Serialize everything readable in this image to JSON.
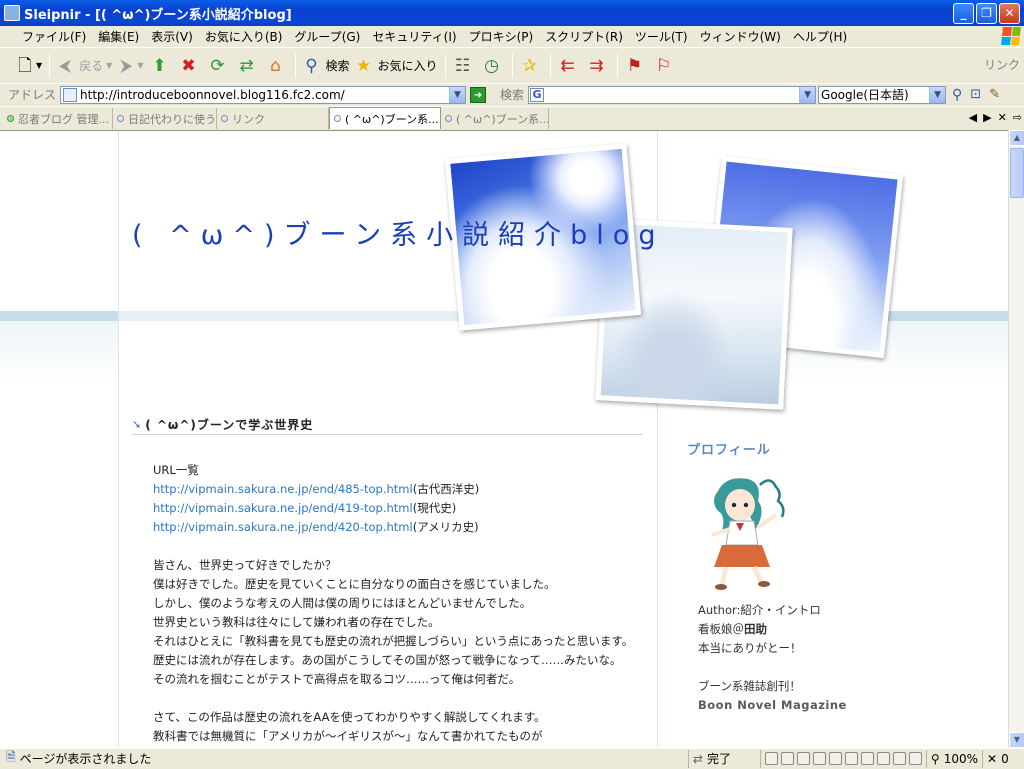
{
  "window": {
    "title": "Sleipnir - [( ^ω^)ブーン系小説紹介blog]"
  },
  "menu": [
    "ファイル(F)",
    "編集(E)",
    "表示(V)",
    "お気に入り(B)",
    "グループ(G)",
    "セキュリティ(I)",
    "プロキシ(P)",
    "スクリプト(R)",
    "ツール(T)",
    "ウィンドウ(W)",
    "ヘルプ(H)"
  ],
  "toolbar": {
    "back_label": "戻る",
    "search_label": "検索",
    "favorites_label": "お気に入り",
    "links_label": "リンク"
  },
  "address": {
    "label": "アドレス",
    "url": "http://introduceboonnovel.blog116.fc2.com/",
    "search_label": "検索",
    "search_value": "",
    "engine": "Google(日本語)"
  },
  "tabs": [
    {
      "label": "忍者ブログ 管理...",
      "icon": "green-dot"
    },
    {
      "label": "日記代わりに使う...",
      "icon": "blue-dot"
    },
    {
      "label": "リンク",
      "icon": "blue-dot"
    },
    {
      "label": "( ^ω^)ブーン系...",
      "icon": "blue-dot",
      "active": true
    },
    {
      "label": "( ^ω^)ブーン系...",
      "icon": "blue-dot"
    }
  ],
  "blog": {
    "title": "( ^ω^)ブーン系小説紹介blog",
    "entry_title": "( ^ω^)ブーンで学ぶ世界史",
    "body": [
      {
        "text": "URL一覧"
      },
      {
        "url": "http://vipmain.sakura.ne.jp/end/485-top.html",
        "note": "(古代西洋史)"
      },
      {
        "url": "http://vipmain.sakura.ne.jp/end/419-top.html",
        "note": "(現代史)"
      },
      {
        "url": "http://vipmain.sakura.ne.jp/end/420-top.html",
        "note": "(アメリカ史)"
      },
      {
        "blank": true
      },
      {
        "text": "皆さん、世界史って好きでしたか？"
      },
      {
        "text": "僕は好きでした。歴史を見ていくことに自分なりの面白さを感じていました。"
      },
      {
        "text": "しかし、僕のような考えの人間は僕の周りにはほとんどいませんでした。"
      },
      {
        "text": "世界史という教科は往々にして嫌われ者の存在でした。"
      },
      {
        "text": "それはひとえに「教科書を見ても歴史の流れが把握しづらい」という点にあったと思います。"
      },
      {
        "text": "歴史には流れが存在します。あの国がこうしてその国が怒って戦争になって……みたいな。"
      },
      {
        "text": "その流れを掴むことがテストで高得点を取るコツ……って俺は何者だ。"
      },
      {
        "blank": true
      },
      {
        "text": "さて、この作品は歴史の流れをAAを使ってわかりやすく解説してくれます。"
      },
      {
        "text": "教科書では無機質に「アメリカが～イギリスが～」なんて書かれてたものが"
      }
    ],
    "profile": {
      "heading": "プロフィール",
      "author": "Author:紹介・イントロ",
      "mascot_prefix": "看板娘＠",
      "mascot_name": "田助",
      "thanks": "本当にありがとー！",
      "announce": "ブーン系雑誌創刊！",
      "magazine": "Boon Novel Magazine"
    }
  },
  "status": {
    "message": "ページが表示されました",
    "state": "完了",
    "zoom": "100%",
    "count": "0"
  },
  "colors": {
    "title_blue": "#1a3fb8",
    "link": "#2a78c8",
    "titlebar": "#0a48d8"
  }
}
